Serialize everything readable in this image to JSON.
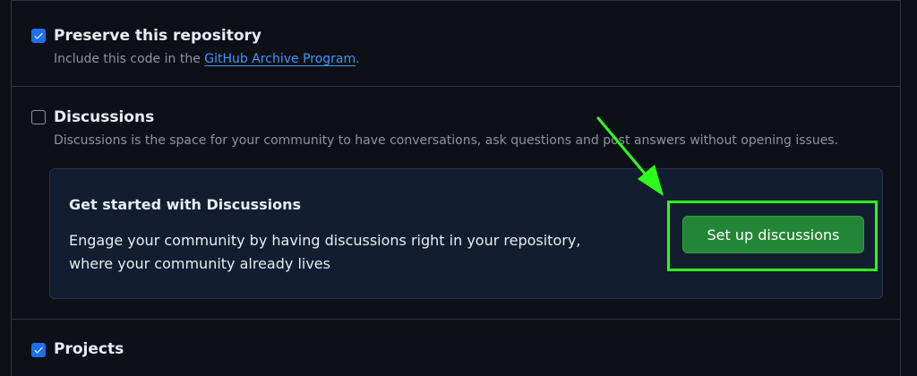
{
  "preserve": {
    "checked": true,
    "title": "Preserve this repository",
    "desc_prefix": "Include this code in the ",
    "link_label": "GitHub Archive Program",
    "desc_suffix": "."
  },
  "discussions": {
    "checked": false,
    "title": "Discussions",
    "description": "Discussions is the space for your community to have conversations, ask questions and post answers without opening issues.",
    "card": {
      "title": "Get started with Discussions",
      "line1": "Engage your community by having discussions right in your repository,",
      "line2": "where your community already lives",
      "button_label": "Set up discussions"
    }
  },
  "projects": {
    "checked": true,
    "title": "Projects"
  },
  "colors": {
    "background": "#0d1117",
    "accent_blue": "#1f6feb",
    "button_green": "#238636",
    "highlight_green": "#2dff1a"
  }
}
